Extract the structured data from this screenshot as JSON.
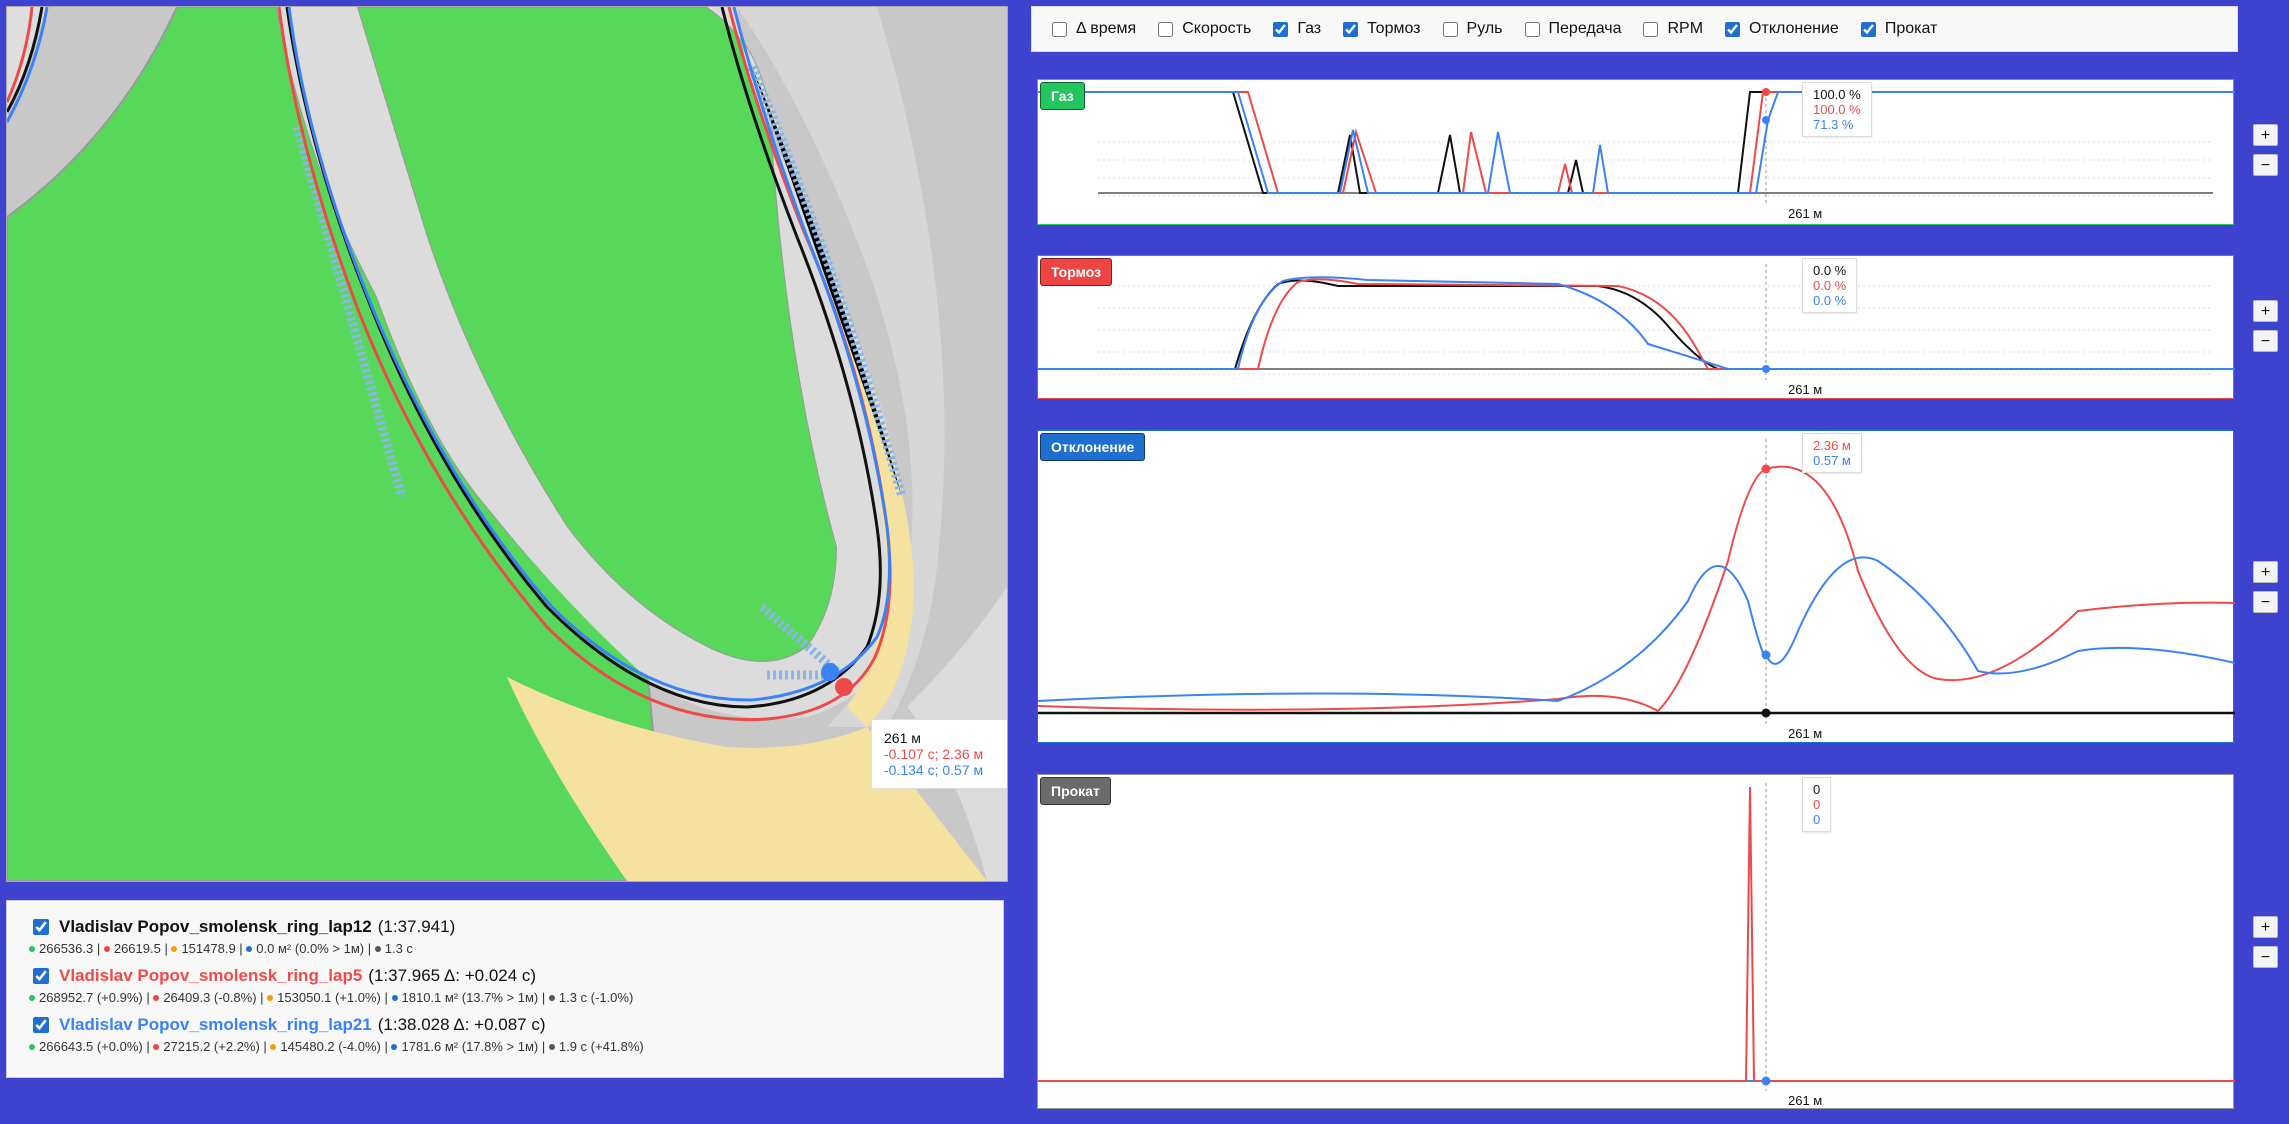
{
  "toolbar": {
    "items": [
      {
        "label": "Δ время",
        "checked": false
      },
      {
        "label": "Скорость",
        "checked": false
      },
      {
        "label": "Газ",
        "checked": true
      },
      {
        "label": "Тормоз",
        "checked": true
      },
      {
        "label": "Руль",
        "checked": false
      },
      {
        "label": "Передача",
        "checked": false
      },
      {
        "label": "RPM",
        "checked": false
      },
      {
        "label": "Отклонение",
        "checked": true
      },
      {
        "label": "Прокат",
        "checked": true
      }
    ]
  },
  "map": {
    "tooltip": {
      "distance": "261 м",
      "red": "-0.107 с; 2.36 м",
      "blue": "-0.134 с; 0.57 м"
    }
  },
  "laps": [
    {
      "name": "Vladislav Popov_smolensk_ring_lap12",
      "time": "(1:37.941)",
      "color": "#111111",
      "checked": true,
      "stats": [
        {
          "color": "#22c55e",
          "text": "266536.3"
        },
        {
          "color": "#ef4444",
          "text": "26619.5"
        },
        {
          "color": "#f59e0b",
          "text": "151478.9"
        },
        {
          "color": "#1f6fd1",
          "text": "0.0 м² (0.0% > 1м)"
        },
        {
          "color": "#555555",
          "text": "1.3 с"
        }
      ]
    },
    {
      "name": "Vladislav Popov_smolensk_ring_lap5",
      "time": "(1:37.965 Δ: +0.024 с)",
      "color": "#ef4a4a",
      "checked": true,
      "stats": [
        {
          "color": "#22c55e",
          "text": "268952.7 (+0.9%)"
        },
        {
          "color": "#ef4444",
          "text": "26409.3 (-0.8%)"
        },
        {
          "color": "#f59e0b",
          "text": "153050.1 (+1.0%)"
        },
        {
          "color": "#1f6fd1",
          "text": "1810.1 м² (13.7% > 1м)"
        },
        {
          "color": "#555555",
          "text": "1.3 с (-1.0%)"
        }
      ]
    },
    {
      "name": "Vladislav Popov_smolensk_ring_lap21",
      "time": "(1:38.028 Δ: +0.087 с)",
      "color": "#3b82f6",
      "checked": true,
      "stats": [
        {
          "color": "#22c55e",
          "text": "266643.5 (+0.0%)"
        },
        {
          "color": "#ef4444",
          "text": "27215.2 (+2.2%)"
        },
        {
          "color": "#f59e0b",
          "text": "145480.2 (-4.0%)"
        },
        {
          "color": "#1f6fd1",
          "text": "1781.6 м² (17.8% > 1м)"
        },
        {
          "color": "#555555",
          "text": "1.9 с (+41.8%)"
        }
      ]
    }
  ],
  "panels": {
    "gas": {
      "label": "Газ",
      "color": "#22c55e",
      "distance": "261 м",
      "tip": [
        "100.0 %",
        "100.0 %",
        "71.3 %"
      ]
    },
    "brake": {
      "label": "Тормоз",
      "color": "#ef4444",
      "distance": "261 м",
      "tip": [
        "0.0 %",
        "0.0 %",
        "0.0 %"
      ]
    },
    "deviation": {
      "label": "Отклонение",
      "color": "#1f6fd1",
      "distance": "261 м",
      "tip": [
        "2.36 м",
        "0.57 м"
      ]
    },
    "roll": {
      "label": "Прокат",
      "color": "#6b6b6b",
      "distance": "261 м",
      "tip": [
        "0",
        "0",
        "0"
      ]
    }
  },
  "zoom": {
    "plus": "+",
    "minus": "−"
  }
}
